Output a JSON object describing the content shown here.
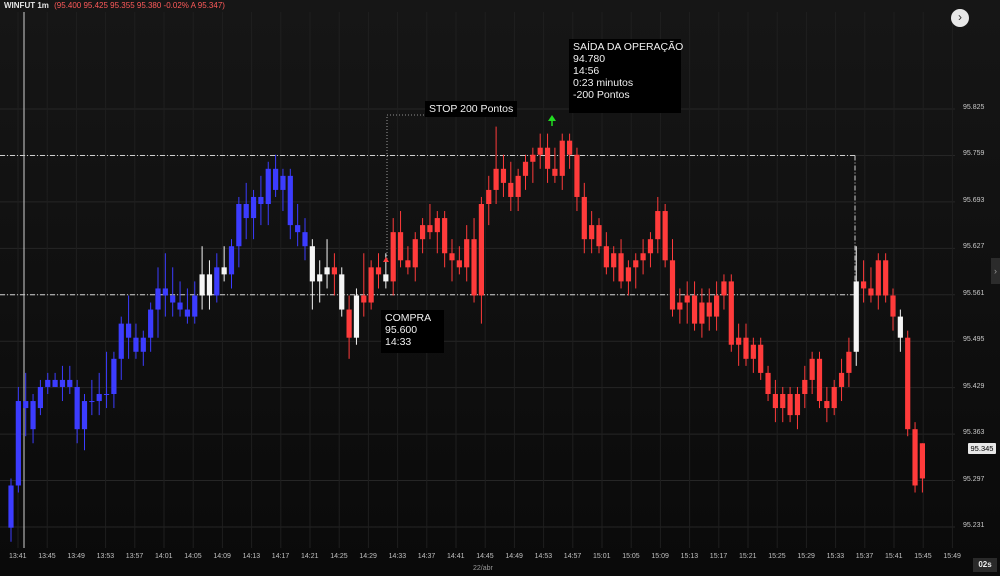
{
  "header": {
    "symbol": "WINFUT 1m",
    "ohlc": "(95.400  95.425  95.355  95.380  -0.02%  A 95.347)"
  },
  "nav_button": "›",
  "side_tab": "›",
  "annotations": {
    "stop": "STOP 200 Pontos",
    "exit": "SAÍDA DA OPERAÇÃO\n94.780\n14:56\n0:23 minutos\n-200 Pontos",
    "buy": "COMPRA\n95.600\n14:33"
  },
  "current_price": "95.345",
  "timer": "02s",
  "date_label": "22/abr",
  "colors": {
    "bull_blue": "#3c3cff",
    "bear_red": "#ff3b3b",
    "white": "#f5f5f5",
    "arrow": "#22dd22"
  },
  "chart_data": {
    "type": "candlestick",
    "y_ticks": [
      "95.825",
      "95.759",
      "95.693",
      "95.627",
      "95.561",
      "95.495",
      "95.429",
      "95.363",
      "95.297",
      "95.231"
    ],
    "x_ticks": [
      "13:41",
      "13:45",
      "13:49",
      "13:53",
      "13:57",
      "14:01",
      "14:05",
      "14:09",
      "14:13",
      "14:17",
      "14:21",
      "14:25",
      "14:29",
      "14:33",
      "14:37",
      "14:41",
      "14:45",
      "14:49",
      "14:53",
      "14:57",
      "15:01",
      "15:05",
      "15:09",
      "15:13",
      "15:17",
      "15:21",
      "15:25",
      "15:29",
      "15:33",
      "15:37",
      "15:41",
      "15:45",
      "15:49"
    ],
    "ylim": [
      95.21,
      95.87
    ],
    "levels": {
      "stop_line": 95.759,
      "entry_line": 95.561
    },
    "candles": [
      {
        "o": 95.23,
        "h": 95.3,
        "l": 95.21,
        "c": 95.29,
        "k": "b"
      },
      {
        "o": 95.29,
        "h": 95.43,
        "l": 95.28,
        "c": 95.41,
        "k": "b"
      },
      {
        "o": 95.41,
        "h": 95.45,
        "l": 95.36,
        "c": 95.4,
        "k": "b"
      },
      {
        "o": 95.37,
        "h": 95.42,
        "l": 95.35,
        "c": 95.41,
        "k": "b"
      },
      {
        "o": 95.4,
        "h": 95.44,
        "l": 95.39,
        "c": 95.43,
        "k": "b"
      },
      {
        "o": 95.43,
        "h": 95.45,
        "l": 95.42,
        "c": 95.44,
        "k": "b"
      },
      {
        "o": 95.44,
        "h": 95.45,
        "l": 95.43,
        "c": 95.43,
        "k": "b"
      },
      {
        "o": 95.43,
        "h": 95.46,
        "l": 95.41,
        "c": 95.44,
        "k": "b"
      },
      {
        "o": 95.44,
        "h": 95.46,
        "l": 95.42,
        "c": 95.43,
        "k": "b"
      },
      {
        "o": 95.43,
        "h": 95.44,
        "l": 95.35,
        "c": 95.37,
        "k": "b"
      },
      {
        "o": 95.37,
        "h": 95.42,
        "l": 95.34,
        "c": 95.41,
        "k": "b"
      },
      {
        "o": 95.41,
        "h": 95.44,
        "l": 95.39,
        "c": 95.41,
        "k": "b"
      },
      {
        "o": 95.41,
        "h": 95.45,
        "l": 95.39,
        "c": 95.42,
        "k": "b"
      },
      {
        "o": 95.42,
        "h": 95.48,
        "l": 95.4,
        "c": 95.42,
        "k": "b"
      },
      {
        "o": 95.42,
        "h": 95.48,
        "l": 95.4,
        "c": 95.47,
        "k": "b"
      },
      {
        "o": 95.47,
        "h": 95.53,
        "l": 95.44,
        "c": 95.52,
        "k": "b"
      },
      {
        "o": 95.52,
        "h": 95.56,
        "l": 95.47,
        "c": 95.5,
        "k": "b"
      },
      {
        "o": 95.5,
        "h": 95.52,
        "l": 95.47,
        "c": 95.48,
        "k": "b"
      },
      {
        "o": 95.48,
        "h": 95.51,
        "l": 95.46,
        "c": 95.5,
        "k": "b"
      },
      {
        "o": 95.5,
        "h": 95.55,
        "l": 95.48,
        "c": 95.54,
        "k": "b"
      },
      {
        "o": 95.54,
        "h": 95.6,
        "l": 95.5,
        "c": 95.57,
        "k": "b"
      },
      {
        "o": 95.57,
        "h": 95.62,
        "l": 95.53,
        "c": 95.56,
        "k": "b"
      },
      {
        "o": 95.56,
        "h": 95.6,
        "l": 95.53,
        "c": 95.55,
        "k": "b"
      },
      {
        "o": 95.55,
        "h": 95.58,
        "l": 95.53,
        "c": 95.54,
        "k": "b"
      },
      {
        "o": 95.54,
        "h": 95.57,
        "l": 95.52,
        "c": 95.53,
        "k": "b"
      },
      {
        "o": 95.53,
        "h": 95.58,
        "l": 95.52,
        "c": 95.56,
        "k": "b"
      },
      {
        "o": 95.56,
        "h": 95.63,
        "l": 95.54,
        "c": 95.59,
        "k": "w"
      },
      {
        "o": 95.59,
        "h": 95.61,
        "l": 95.54,
        "c": 95.56,
        "k": "w"
      },
      {
        "o": 95.56,
        "h": 95.62,
        "l": 95.55,
        "c": 95.6,
        "k": "b"
      },
      {
        "o": 95.6,
        "h": 95.63,
        "l": 95.58,
        "c": 95.59,
        "k": "w"
      },
      {
        "o": 95.59,
        "h": 95.64,
        "l": 95.57,
        "c": 95.63,
        "k": "b"
      },
      {
        "o": 95.63,
        "h": 95.7,
        "l": 95.6,
        "c": 95.69,
        "k": "b"
      },
      {
        "o": 95.69,
        "h": 95.72,
        "l": 95.64,
        "c": 95.67,
        "k": "b"
      },
      {
        "o": 95.67,
        "h": 95.71,
        "l": 95.64,
        "c": 95.7,
        "k": "b"
      },
      {
        "o": 95.7,
        "h": 95.73,
        "l": 95.66,
        "c": 95.69,
        "k": "b"
      },
      {
        "o": 95.69,
        "h": 95.75,
        "l": 95.66,
        "c": 95.74,
        "k": "b"
      },
      {
        "o": 95.74,
        "h": 95.76,
        "l": 95.7,
        "c": 95.71,
        "k": "b"
      },
      {
        "o": 95.71,
        "h": 95.74,
        "l": 95.68,
        "c": 95.73,
        "k": "b"
      },
      {
        "o": 95.73,
        "h": 95.74,
        "l": 95.64,
        "c": 95.66,
        "k": "b"
      },
      {
        "o": 95.66,
        "h": 95.69,
        "l": 95.63,
        "c": 95.65,
        "k": "b"
      },
      {
        "o": 95.65,
        "h": 95.67,
        "l": 95.61,
        "c": 95.63,
        "k": "b"
      },
      {
        "o": 95.63,
        "h": 95.64,
        "l": 95.54,
        "c": 95.58,
        "k": "w"
      },
      {
        "o": 95.58,
        "h": 95.61,
        "l": 95.55,
        "c": 95.59,
        "k": "w"
      },
      {
        "o": 95.59,
        "h": 95.64,
        "l": 95.57,
        "c": 95.6,
        "k": "w"
      },
      {
        "o": 95.6,
        "h": 95.62,
        "l": 95.56,
        "c": 95.59,
        "k": "r"
      },
      {
        "o": 95.59,
        "h": 95.6,
        "l": 95.53,
        "c": 95.54,
        "k": "w"
      },
      {
        "o": 95.54,
        "h": 95.56,
        "l": 95.47,
        "c": 95.5,
        "k": "r"
      },
      {
        "o": 95.5,
        "h": 95.57,
        "l": 95.49,
        "c": 95.56,
        "k": "w"
      },
      {
        "o": 95.56,
        "h": 95.62,
        "l": 95.53,
        "c": 95.55,
        "k": "r"
      },
      {
        "o": 95.55,
        "h": 95.61,
        "l": 95.54,
        "c": 95.6,
        "k": "r"
      },
      {
        "o": 95.6,
        "h": 95.62,
        "l": 95.57,
        "c": 95.59,
        "k": "r"
      },
      {
        "o": 95.59,
        "h": 95.62,
        "l": 95.57,
        "c": 95.58,
        "k": "w"
      },
      {
        "o": 95.58,
        "h": 95.67,
        "l": 95.56,
        "c": 95.65,
        "k": "r"
      },
      {
        "o": 95.65,
        "h": 95.68,
        "l": 95.6,
        "c": 95.61,
        "k": "r"
      },
      {
        "o": 95.61,
        "h": 95.63,
        "l": 95.59,
        "c": 95.6,
        "k": "r"
      },
      {
        "o": 95.6,
        "h": 95.65,
        "l": 95.58,
        "c": 95.64,
        "k": "r"
      },
      {
        "o": 95.64,
        "h": 95.67,
        "l": 95.62,
        "c": 95.66,
        "k": "r"
      },
      {
        "o": 95.66,
        "h": 95.69,
        "l": 95.64,
        "c": 95.65,
        "k": "r"
      },
      {
        "o": 95.65,
        "h": 95.68,
        "l": 95.62,
        "c": 95.67,
        "k": "r"
      },
      {
        "o": 95.67,
        "h": 95.68,
        "l": 95.6,
        "c": 95.62,
        "k": "r"
      },
      {
        "o": 95.62,
        "h": 95.64,
        "l": 95.58,
        "c": 95.61,
        "k": "r"
      },
      {
        "o": 95.61,
        "h": 95.63,
        "l": 95.59,
        "c": 95.6,
        "k": "r"
      },
      {
        "o": 95.6,
        "h": 95.66,
        "l": 95.58,
        "c": 95.64,
        "k": "r"
      },
      {
        "o": 95.64,
        "h": 95.67,
        "l": 95.55,
        "c": 95.56,
        "k": "r"
      },
      {
        "o": 95.56,
        "h": 95.7,
        "l": 95.52,
        "c": 95.69,
        "k": "r"
      },
      {
        "o": 95.69,
        "h": 95.73,
        "l": 95.66,
        "c": 95.71,
        "k": "r"
      },
      {
        "o": 95.71,
        "h": 95.8,
        "l": 95.69,
        "c": 95.74,
        "k": "r"
      },
      {
        "o": 95.74,
        "h": 95.76,
        "l": 95.7,
        "c": 95.72,
        "k": "r"
      },
      {
        "o": 95.72,
        "h": 95.75,
        "l": 95.68,
        "c": 95.7,
        "k": "r"
      },
      {
        "o": 95.7,
        "h": 95.74,
        "l": 95.68,
        "c": 95.73,
        "k": "r"
      },
      {
        "o": 95.73,
        "h": 95.76,
        "l": 95.71,
        "c": 95.75,
        "k": "r"
      },
      {
        "o": 95.75,
        "h": 95.77,
        "l": 95.72,
        "c": 95.76,
        "k": "r"
      },
      {
        "o": 95.76,
        "h": 95.79,
        "l": 95.74,
        "c": 95.77,
        "k": "r"
      },
      {
        "o": 95.77,
        "h": 95.79,
        "l": 95.72,
        "c": 95.74,
        "k": "r"
      },
      {
        "o": 95.74,
        "h": 95.77,
        "l": 95.72,
        "c": 95.73,
        "k": "r"
      },
      {
        "o": 95.73,
        "h": 95.79,
        "l": 95.71,
        "c": 95.78,
        "k": "r"
      },
      {
        "o": 95.78,
        "h": 95.79,
        "l": 95.74,
        "c": 95.76,
        "k": "r"
      },
      {
        "o": 95.76,
        "h": 95.77,
        "l": 95.68,
        "c": 95.7,
        "k": "r"
      },
      {
        "o": 95.7,
        "h": 95.72,
        "l": 95.62,
        "c": 95.64,
        "k": "r"
      },
      {
        "o": 95.64,
        "h": 95.68,
        "l": 95.62,
        "c": 95.66,
        "k": "r"
      },
      {
        "o": 95.66,
        "h": 95.67,
        "l": 95.62,
        "c": 95.63,
        "k": "r"
      },
      {
        "o": 95.63,
        "h": 95.65,
        "l": 95.59,
        "c": 95.6,
        "k": "r"
      },
      {
        "o": 95.6,
        "h": 95.63,
        "l": 95.58,
        "c": 95.62,
        "k": "r"
      },
      {
        "o": 95.62,
        "h": 95.64,
        "l": 95.57,
        "c": 95.58,
        "k": "r"
      },
      {
        "o": 95.58,
        "h": 95.61,
        "l": 95.56,
        "c": 95.6,
        "k": "r"
      },
      {
        "o": 95.6,
        "h": 95.62,
        "l": 95.57,
        "c": 95.61,
        "k": "r"
      },
      {
        "o": 95.61,
        "h": 95.64,
        "l": 95.59,
        "c": 95.62,
        "k": "r"
      },
      {
        "o": 95.62,
        "h": 95.65,
        "l": 95.6,
        "c": 95.64,
        "k": "r"
      },
      {
        "o": 95.64,
        "h": 95.7,
        "l": 95.62,
        "c": 95.68,
        "k": "r"
      },
      {
        "o": 95.68,
        "h": 95.69,
        "l": 95.6,
        "c": 95.61,
        "k": "r"
      },
      {
        "o": 95.61,
        "h": 95.64,
        "l": 95.53,
        "c": 95.54,
        "k": "r"
      },
      {
        "o": 95.54,
        "h": 95.57,
        "l": 95.52,
        "c": 95.55,
        "k": "r"
      },
      {
        "o": 95.55,
        "h": 95.58,
        "l": 95.52,
        "c": 95.56,
        "k": "r"
      },
      {
        "o": 95.56,
        "h": 95.58,
        "l": 95.51,
        "c": 95.52,
        "k": "r"
      },
      {
        "o": 95.52,
        "h": 95.57,
        "l": 95.5,
        "c": 95.55,
        "k": "r"
      },
      {
        "o": 95.55,
        "h": 95.57,
        "l": 95.51,
        "c": 95.53,
        "k": "r"
      },
      {
        "o": 95.53,
        "h": 95.58,
        "l": 95.51,
        "c": 95.56,
        "k": "r"
      },
      {
        "o": 95.56,
        "h": 95.59,
        "l": 95.54,
        "c": 95.58,
        "k": "r"
      },
      {
        "o": 95.58,
        "h": 95.59,
        "l": 95.48,
        "c": 95.49,
        "k": "r"
      },
      {
        "o": 95.49,
        "h": 95.52,
        "l": 95.46,
        "c": 95.5,
        "k": "r"
      },
      {
        "o": 95.5,
        "h": 95.52,
        "l": 95.46,
        "c": 95.47,
        "k": "r"
      },
      {
        "o": 95.47,
        "h": 95.5,
        "l": 95.45,
        "c": 95.49,
        "k": "r"
      },
      {
        "o": 95.49,
        "h": 95.5,
        "l": 95.44,
        "c": 95.45,
        "k": "r"
      },
      {
        "o": 95.45,
        "h": 95.46,
        "l": 95.41,
        "c": 95.42,
        "k": "r"
      },
      {
        "o": 95.42,
        "h": 95.44,
        "l": 95.38,
        "c": 95.4,
        "k": "r"
      },
      {
        "o": 95.4,
        "h": 95.43,
        "l": 95.38,
        "c": 95.42,
        "k": "r"
      },
      {
        "o": 95.42,
        "h": 95.43,
        "l": 95.38,
        "c": 95.39,
        "k": "r"
      },
      {
        "o": 95.39,
        "h": 95.43,
        "l": 95.37,
        "c": 95.42,
        "k": "r"
      },
      {
        "o": 95.42,
        "h": 95.46,
        "l": 95.4,
        "c": 95.44,
        "k": "r"
      },
      {
        "o": 95.44,
        "h": 95.48,
        "l": 95.42,
        "c": 95.47,
        "k": "r"
      },
      {
        "o": 95.47,
        "h": 95.48,
        "l": 95.4,
        "c": 95.41,
        "k": "r"
      },
      {
        "o": 95.41,
        "h": 95.43,
        "l": 95.38,
        "c": 95.4,
        "k": "r"
      },
      {
        "o": 95.4,
        "h": 95.44,
        "l": 95.39,
        "c": 95.43,
        "k": "r"
      },
      {
        "o": 95.43,
        "h": 95.47,
        "l": 95.41,
        "c": 95.45,
        "k": "r"
      },
      {
        "o": 95.45,
        "h": 95.5,
        "l": 95.43,
        "c": 95.48,
        "k": "r"
      },
      {
        "o": 95.48,
        "h": 95.63,
        "l": 95.46,
        "c": 95.58,
        "k": "w"
      },
      {
        "o": 95.58,
        "h": 95.61,
        "l": 95.55,
        "c": 95.57,
        "k": "r"
      },
      {
        "o": 95.57,
        "h": 95.6,
        "l": 95.55,
        "c": 95.56,
        "k": "r"
      },
      {
        "o": 95.56,
        "h": 95.62,
        "l": 95.54,
        "c": 95.61,
        "k": "r"
      },
      {
        "o": 95.61,
        "h": 95.62,
        "l": 95.55,
        "c": 95.56,
        "k": "r"
      },
      {
        "o": 95.56,
        "h": 95.57,
        "l": 95.51,
        "c": 95.53,
        "k": "r"
      },
      {
        "o": 95.53,
        "h": 95.54,
        "l": 95.48,
        "c": 95.5,
        "k": "w"
      },
      {
        "o": 95.5,
        "h": 95.51,
        "l": 95.36,
        "c": 95.37,
        "k": "r"
      },
      {
        "o": 95.37,
        "h": 95.38,
        "l": 95.28,
        "c": 95.29,
        "k": "r"
      },
      {
        "o": 95.35,
        "h": 95.35,
        "l": 95.28,
        "c": 95.3,
        "k": "r"
      }
    ]
  }
}
